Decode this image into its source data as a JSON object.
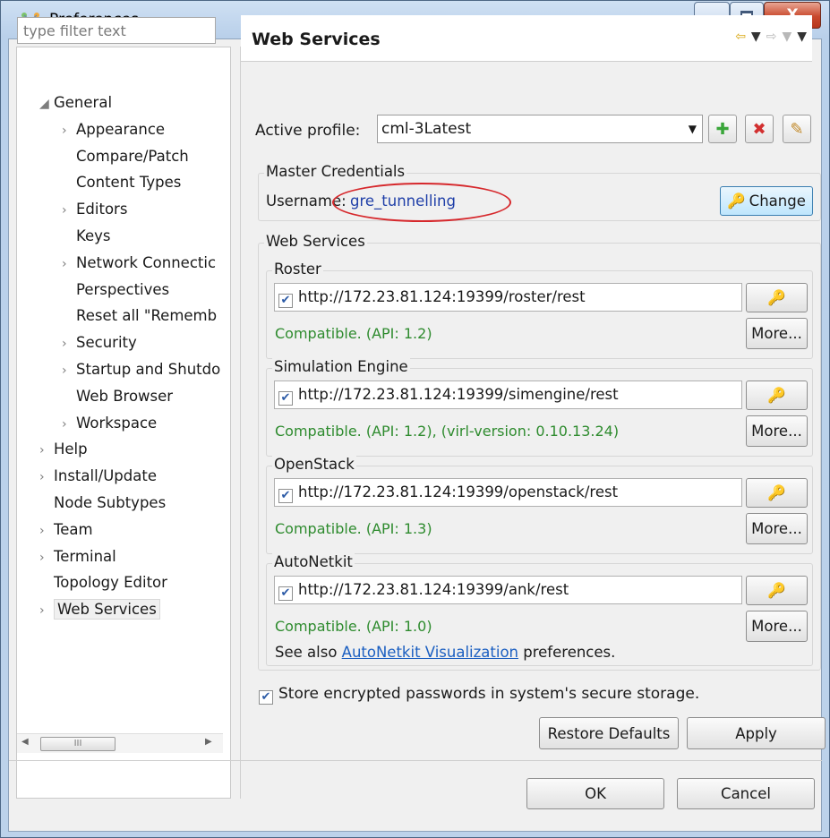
{
  "window": {
    "title": "Preferences",
    "minimize_label": "—",
    "maximize_label": "☐",
    "close_label": "X"
  },
  "filter": {
    "placeholder": "type filter text"
  },
  "tree": {
    "items": [
      {
        "label": "General",
        "arrow": "◢",
        "indent": 0
      },
      {
        "label": "Appearance",
        "arrow": "›",
        "indent": 1
      },
      {
        "label": "Compare/Patch",
        "arrow": "",
        "indent": 1
      },
      {
        "label": "Content Types",
        "arrow": "",
        "indent": 1
      },
      {
        "label": "Editors",
        "arrow": "›",
        "indent": 1
      },
      {
        "label": "Keys",
        "arrow": "",
        "indent": 1
      },
      {
        "label": "Network Connectic",
        "arrow": "›",
        "indent": 1
      },
      {
        "label": "Perspectives",
        "arrow": "",
        "indent": 1
      },
      {
        "label": "Reset all \"Rememb",
        "arrow": "",
        "indent": 1
      },
      {
        "label": "Security",
        "arrow": "›",
        "indent": 1
      },
      {
        "label": "Startup and Shutdo",
        "arrow": "›",
        "indent": 1
      },
      {
        "label": "Web Browser",
        "arrow": "",
        "indent": 1
      },
      {
        "label": "Workspace",
        "arrow": "›",
        "indent": 1
      },
      {
        "label": "Help",
        "arrow": "›",
        "indent": 0
      },
      {
        "label": "Install/Update",
        "arrow": "›",
        "indent": 0
      },
      {
        "label": "Node Subtypes",
        "arrow": "",
        "indent": 0
      },
      {
        "label": "Team",
        "arrow": "›",
        "indent": 0
      },
      {
        "label": "Terminal",
        "arrow": "›",
        "indent": 0
      },
      {
        "label": "Topology Editor",
        "arrow": "",
        "indent": 0
      },
      {
        "label": "Web Services",
        "arrow": "›",
        "indent": 0,
        "selected": true
      }
    ],
    "scroll_thumb": "III"
  },
  "page": {
    "title": "Web Services",
    "active_profile_label": "Active profile:",
    "active_profile_value": "cml-3Latest"
  },
  "credentials": {
    "group_title": "Master Credentials",
    "username_label": "Username:",
    "username_value": "gre_tunnelling",
    "change_label": "Change"
  },
  "services": {
    "group_title": "Web Services",
    "items": [
      {
        "title": "Roster",
        "url": "http://172.23.81.124:19399/roster/rest",
        "status": "Compatible. (API: 1.2)",
        "more": "More..."
      },
      {
        "title": "Simulation Engine",
        "url": "http://172.23.81.124:19399/simengine/rest",
        "status": "Compatible. (API: 1.2), (virl-version: 0.10.13.24)",
        "more": "More..."
      },
      {
        "title": "OpenStack",
        "url": "http://172.23.81.124:19399/openstack/rest",
        "status": "Compatible. (API: 1.3)",
        "more": "More..."
      },
      {
        "title": "AutoNetkit",
        "url": "http://172.23.81.124:19399/ank/rest",
        "status": "Compatible. (API: 1.0)",
        "more": "More..."
      }
    ],
    "see_also_prefix": "See also ",
    "see_also_link": "AutoNetkit Visualization",
    "see_also_suffix": " preferences."
  },
  "store_checkbox": "Store encrypted passwords in system's secure storage.",
  "buttons": {
    "restore_defaults": "Restore Defaults",
    "apply": "Apply",
    "ok": "OK",
    "cancel": "Cancel"
  },
  "colors": {
    "status_green": "#2e8b2e",
    "highlight_red": "#d6282c",
    "link_blue": "#1b5fc1",
    "username_blue": "#1f3fa8"
  }
}
